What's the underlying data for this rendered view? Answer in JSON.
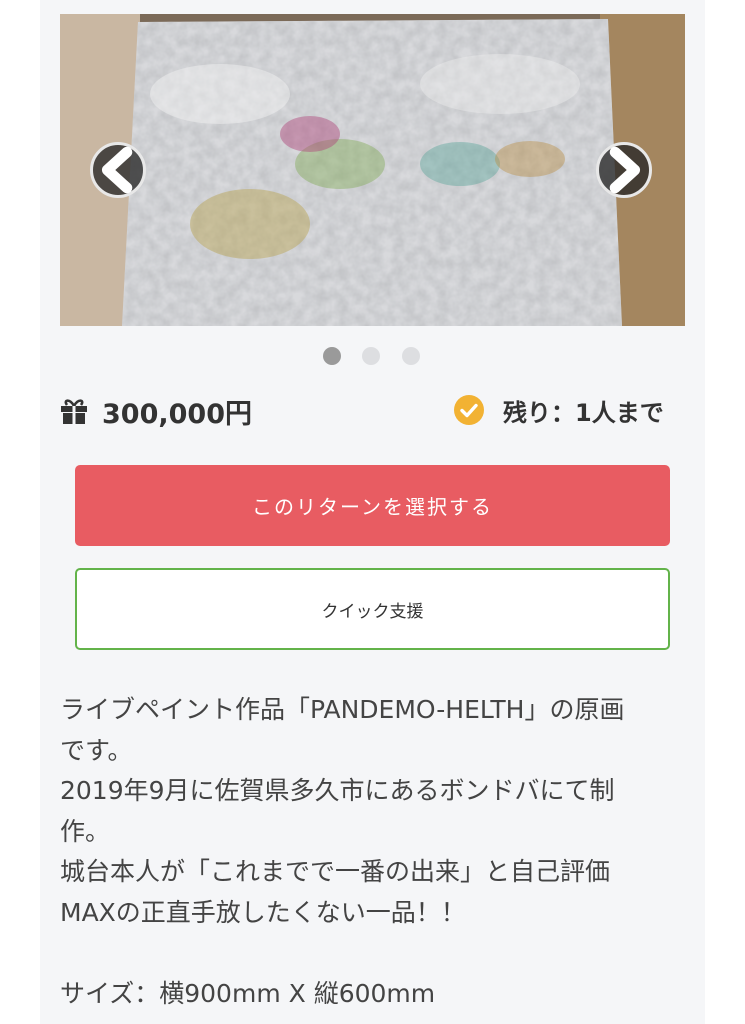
{
  "gallery": {
    "prev_icon": "chevron-left-icon",
    "next_icon": "chevron-right-icon",
    "slide_count": 3,
    "active_slide": 1
  },
  "reward": {
    "gift_icon": "gift-icon",
    "price": "300,000円",
    "check_icon": "check-circle-icon",
    "remaining": "残り：1人まで",
    "accent_colors": {
      "select": "#e85c62",
      "quick_border": "#63b34a",
      "check": "#f2b233"
    }
  },
  "buttons": {
    "select_label": "このリターンを選択する",
    "quick_label": "クイック支援"
  },
  "description": {
    "lines": [
      "ライブペイント作品「PANDEMO-HELTH」の原画",
      "です。",
      "2019年9月に佐賀県多久市にあるボンドバにて制",
      "作。",
      "城台本人が「これまでで一番の出来」と自己評価",
      "MAXの正直手放したくない一品！！"
    ],
    "size": "サイズ：横900mm X 縦600mm"
  }
}
